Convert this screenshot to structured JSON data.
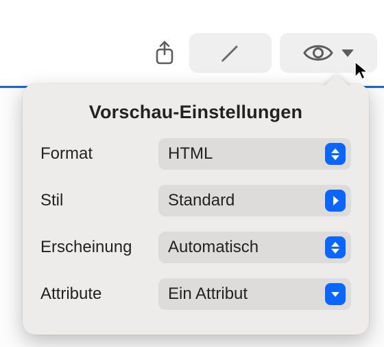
{
  "popover": {
    "title": "Vorschau-Einstellungen",
    "rows": {
      "format": {
        "label": "Format",
        "value": "HTML",
        "control": "updown"
      },
      "stil": {
        "label": "Stil",
        "value": "Standard",
        "control": "right"
      },
      "erscheinung": {
        "label": "Erscheinung",
        "value": "Automatisch",
        "control": "updown"
      },
      "attribute": {
        "label": "Attribute",
        "value": "Ein Attribut",
        "control": "down"
      }
    }
  },
  "toolbar": {
    "share_icon": "share-icon",
    "edit_icon": "pencil-icon",
    "view_icon": "eye-icon"
  }
}
